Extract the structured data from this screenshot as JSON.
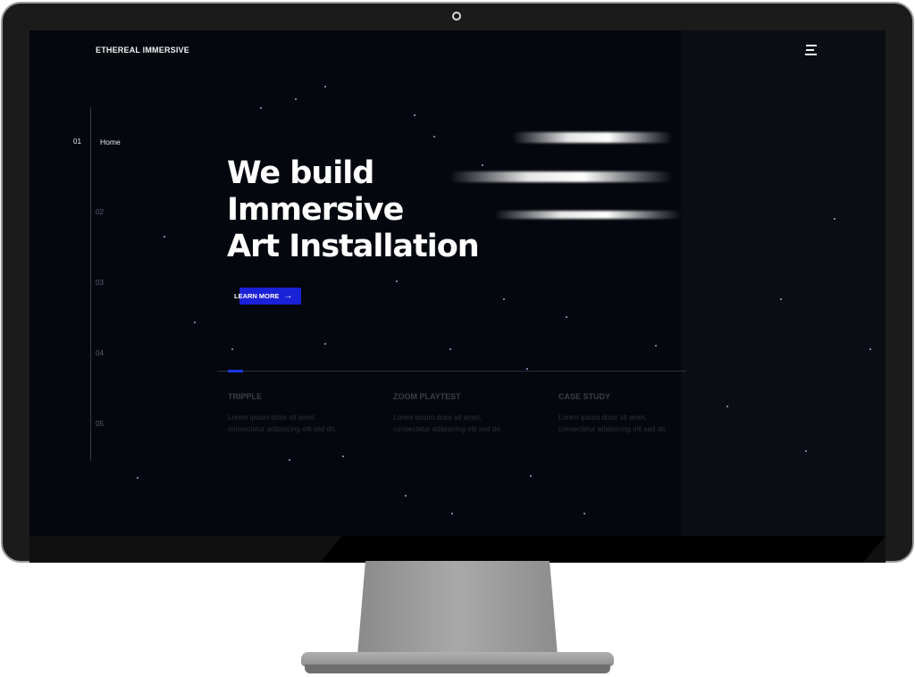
{
  "site": {
    "brand": "ETHEREAL IMMERSIVE",
    "accent_color": "#1a21d6"
  },
  "nav": {
    "items": [
      {
        "number": "01",
        "label": "Home",
        "active": true
      },
      {
        "number": "02"
      },
      {
        "number": "03"
      },
      {
        "number": "04"
      },
      {
        "number": "05"
      }
    ]
  },
  "hero": {
    "lines": [
      "We build",
      "Immersive",
      "Art Installation"
    ],
    "cta_label": "LEARN MORE",
    "cta_icon": "arrow-right-icon"
  },
  "features": [
    {
      "title": "TRIPPLE",
      "text_1": "Lorem ipsum dolor sit amet,",
      "text_2": "consectetur adipisicing elit sed do."
    },
    {
      "title": "ZOOM PLAYTEST",
      "text_1": "Lorem ipsum dolor sit amet,",
      "text_2": "consectetur adipisicing elit sed do."
    },
    {
      "title": "CASE STUDY",
      "text_1": "Lorem ipsum dolor sit amet,",
      "text_2": "consectetur adipisicing elit sed do."
    }
  ],
  "icons": {
    "menu": "hamburger-menu-icon",
    "camera": "webcam-icon"
  }
}
